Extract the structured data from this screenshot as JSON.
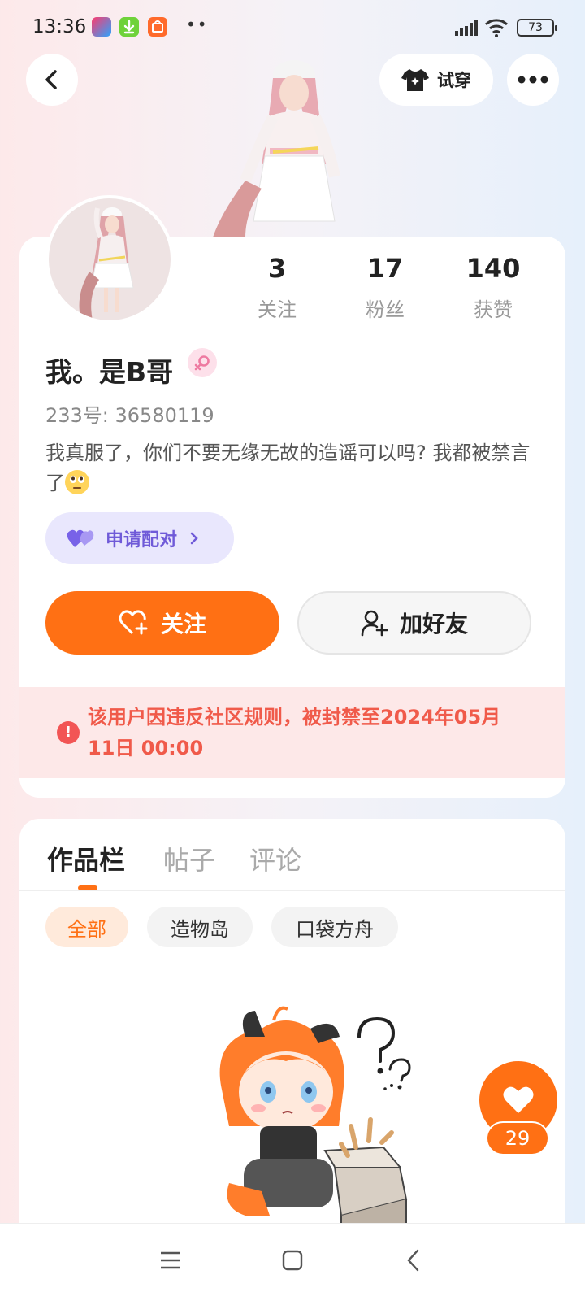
{
  "status_bar": {
    "time": "13:36",
    "battery": "73"
  },
  "header": {
    "try_on_label": "试穿"
  },
  "profile": {
    "stats": [
      {
        "num": "3",
        "label": "关注"
      },
      {
        "num": "17",
        "label": "粉丝"
      },
      {
        "num": "140",
        "label": "获赞"
      }
    ],
    "username": "我。是B哥",
    "uid": "233号: 36580119",
    "bio": "我真服了，你们不要无缘无故的造谣可以吗? 我都被禁言了",
    "pair_label": "申请配对",
    "follow_label": "关注",
    "add_friend_label": "加好友",
    "ban_notice": "该用户因违反社区规则，被封禁至2024年05月11日 00:00"
  },
  "works": {
    "tabs": [
      "作品栏",
      "帖子",
      "评论"
    ],
    "active_tab": 0,
    "chips": [
      "全部",
      "造物岛",
      "口袋方舟"
    ],
    "active_chip": 0
  },
  "like_fab": {
    "count": "29"
  },
  "colors": {
    "accent": "#ff7014",
    "ban_text": "#f05a4a",
    "ban_bg": "#fde8e8",
    "pair_bg": "#e9e7fd",
    "pair_text": "#6f5ad8"
  }
}
